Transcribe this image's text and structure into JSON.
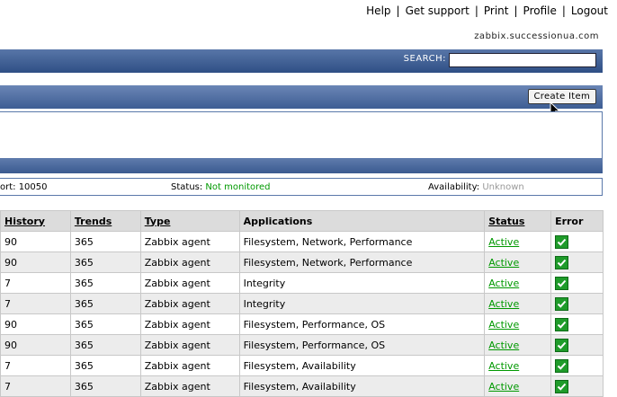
{
  "top_links": [
    "Help",
    "Get support",
    "Print",
    "Profile",
    "Logout"
  ],
  "hostname": "zabbix.successionua.com",
  "search": {
    "label": "SEARCH:",
    "value": ""
  },
  "create_item_label": "Create Item",
  "host_info": {
    "port": "ort: 10050",
    "status_label": "Status:",
    "status_value": "Not monitored",
    "availability_label": "Availability:",
    "availability_value": "Unknown"
  },
  "colors": {
    "status_green": "#009900",
    "bar_blue": "#3d5d93"
  },
  "table": {
    "headers": [
      "History",
      "Trends",
      "Type",
      "Applications",
      "Status",
      "Error"
    ],
    "rows": [
      {
        "history": "90",
        "trends": "365",
        "type": "Zabbix agent",
        "applications": "Filesystem, Network, Performance",
        "status": "Active",
        "error": "ok-icon"
      },
      {
        "history": "90",
        "trends": "365",
        "type": "Zabbix agent",
        "applications": "Filesystem, Network, Performance",
        "status": "Active",
        "error": "ok-icon"
      },
      {
        "history": "7",
        "trends": "365",
        "type": "Zabbix agent",
        "applications": "Integrity",
        "status": "Active",
        "error": "ok-icon"
      },
      {
        "history": "7",
        "trends": "365",
        "type": "Zabbix agent",
        "applications": "Integrity",
        "status": "Active",
        "error": "ok-icon"
      },
      {
        "history": "90",
        "trends": "365",
        "type": "Zabbix agent",
        "applications": "Filesystem, Performance, OS",
        "status": "Active",
        "error": "ok-icon"
      },
      {
        "history": "90",
        "trends": "365",
        "type": "Zabbix agent",
        "applications": "Filesystem, Performance, OS",
        "status": "Active",
        "error": "ok-icon"
      },
      {
        "history": "7",
        "trends": "365",
        "type": "Zabbix agent",
        "applications": "Filesystem, Availability",
        "status": "Active",
        "error": "ok-icon"
      },
      {
        "history": "7",
        "trends": "365",
        "type": "Zabbix agent",
        "applications": "Filesystem, Availability",
        "status": "Active",
        "error": "ok-icon"
      }
    ]
  }
}
